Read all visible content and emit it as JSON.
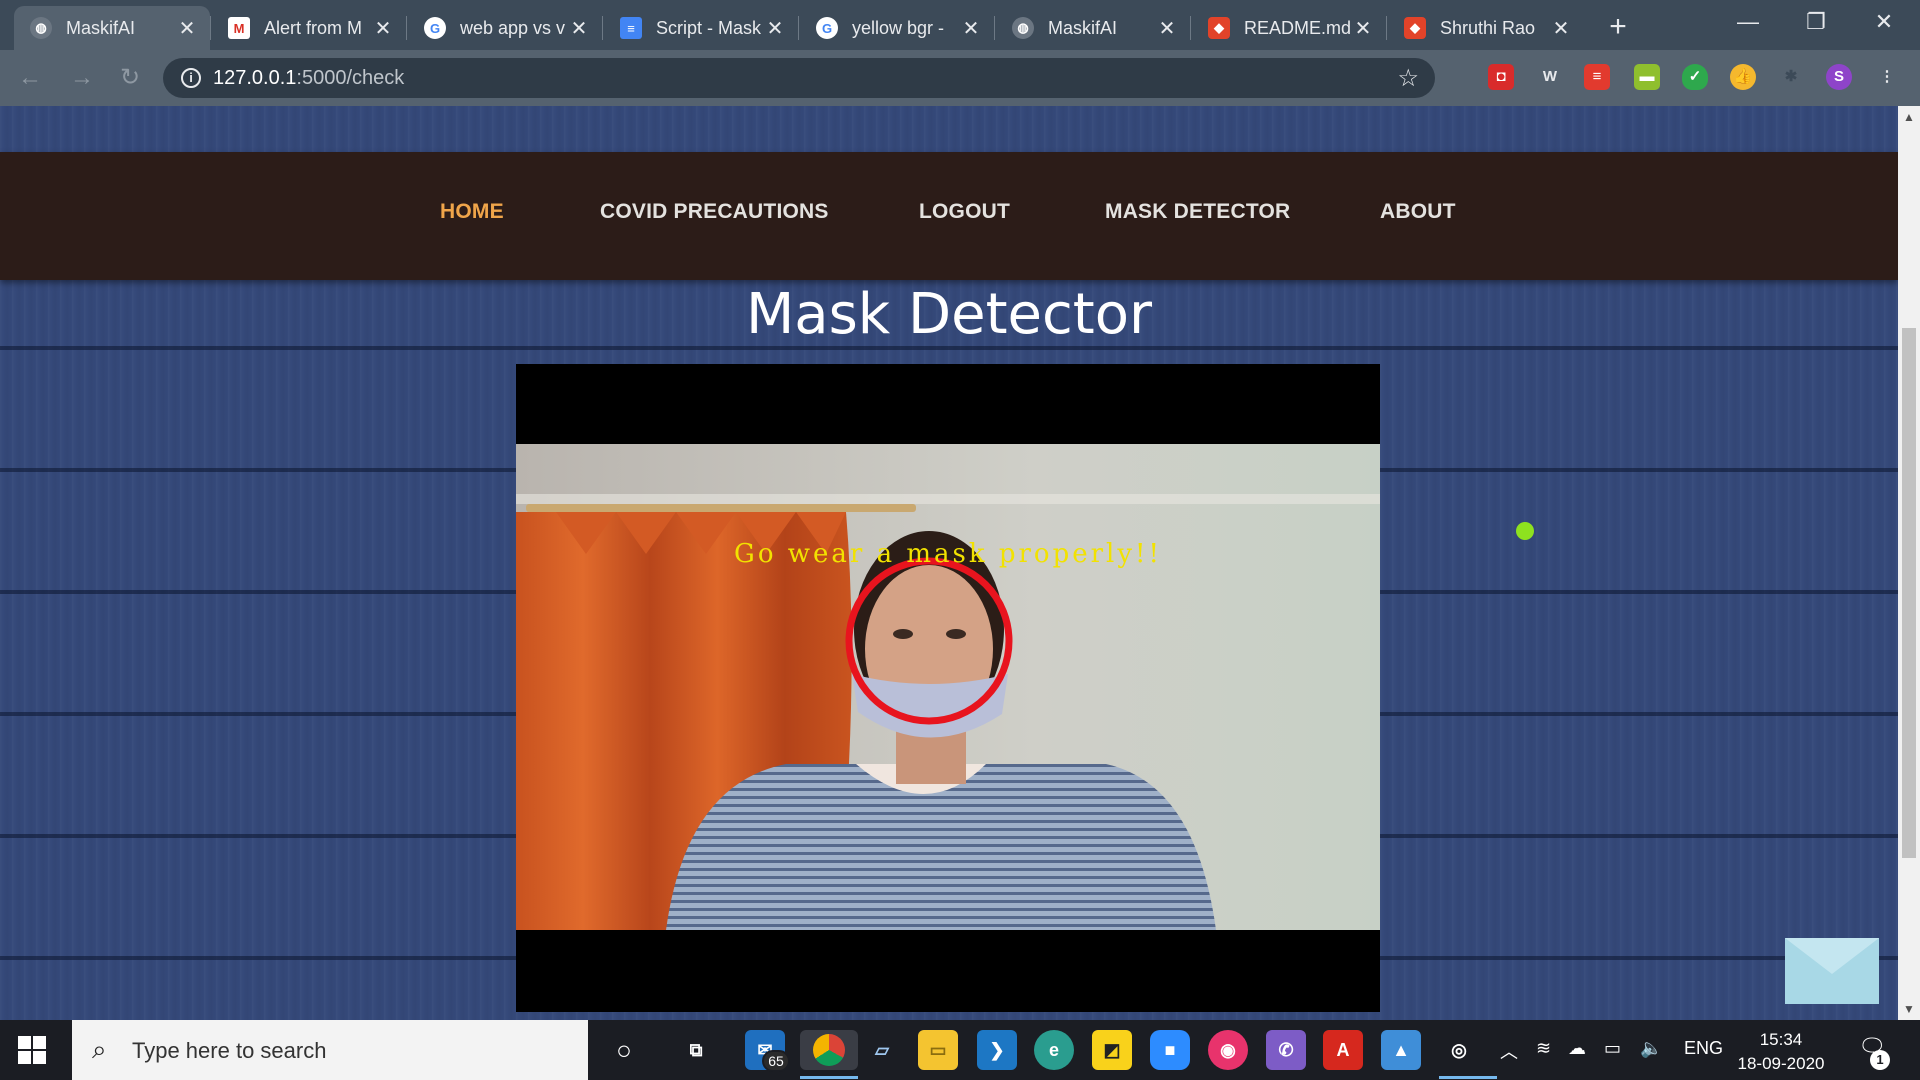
{
  "browser": {
    "tabs": [
      {
        "title": "MaskifAI",
        "icon": "globe-icon",
        "active": true
      },
      {
        "title": "Alert from M",
        "icon": "gmail-icon"
      },
      {
        "title": "web app vs v",
        "icon": "google-icon"
      },
      {
        "title": "Script - Mask",
        "icon": "docs-icon"
      },
      {
        "title": "yellow bgr -",
        "icon": "google-icon"
      },
      {
        "title": "MaskifAI",
        "icon": "globe-icon"
      },
      {
        "title": "README.md",
        "icon": "gitlab-icon"
      },
      {
        "title": "Shruthi Rao",
        "icon": "gitlab-icon"
      }
    ],
    "url_host": "127.0.0.1",
    "url_path": ":5000/check",
    "profile_initial": "S"
  },
  "page": {
    "nav": [
      {
        "label": "HOME",
        "active": true
      },
      {
        "label": "COVID PRECAUTIONS"
      },
      {
        "label": "LOGOUT"
      },
      {
        "label": "MASK DETECTOR"
      },
      {
        "label": "ABOUT"
      }
    ],
    "title": "Mask Detector",
    "video_overlay_text": "Go wear a mask properly!!",
    "accent_color": "#f0a54a",
    "detection_color": "#e8141e"
  },
  "taskbar": {
    "search_placeholder": "Type here to search",
    "mail_badge": "65",
    "language": "ENG",
    "time": "15:34",
    "date": "18-09-2020",
    "notification_count": "1"
  }
}
